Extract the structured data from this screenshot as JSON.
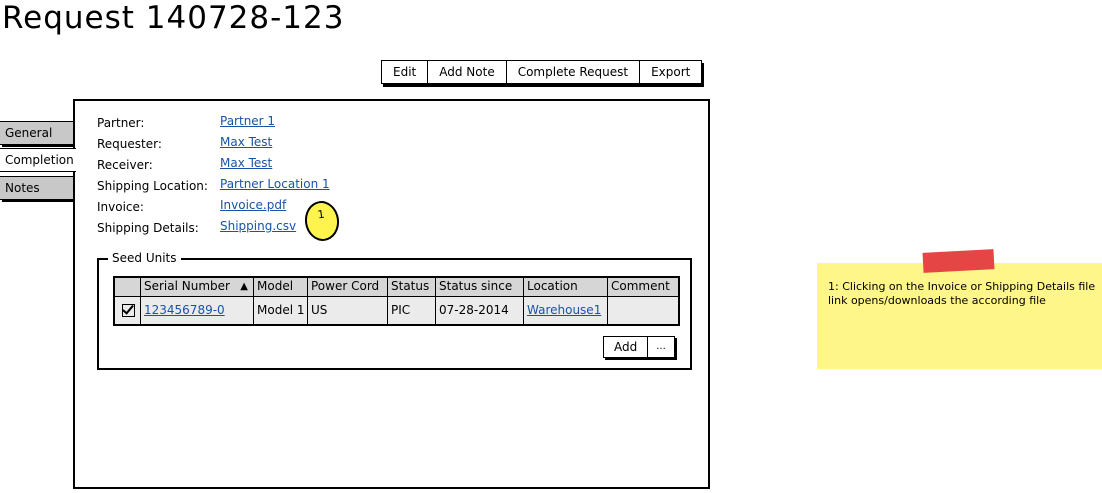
{
  "page": {
    "title": "Request 140728-123"
  },
  "toolbar": {
    "buttons": [
      "Edit",
      "Add Note",
      "Complete Request",
      "Export"
    ]
  },
  "tabs": [
    {
      "label": "General",
      "active": false
    },
    {
      "label": "Completion",
      "active": true
    },
    {
      "label": "Notes",
      "active": false
    }
  ],
  "details": {
    "fields": [
      {
        "label": "Partner:",
        "value": "Partner 1"
      },
      {
        "label": "Requester:",
        "value": "Max Test"
      },
      {
        "label": "Receiver:",
        "value": "Max Test"
      },
      {
        "label": "Shipping Location:",
        "value": "Partner Location 1"
      },
      {
        "label": "Invoice:",
        "value": "Invoice.pdf"
      },
      {
        "label": "Shipping Details:",
        "value": "Shipping.csv"
      }
    ],
    "callout_number": "1"
  },
  "seed_units": {
    "label": "Seed Units",
    "columns": [
      "",
      "Serial Number",
      "Model",
      "Power Cord",
      "Status",
      "Status since",
      "Location",
      "Comment"
    ],
    "sort_indicator": "▲",
    "rows": [
      {
        "checked": true,
        "serial": "123456789-0",
        "model": "Model 1",
        "power_cord": "US",
        "status": "PIC",
        "status_since": "07-28-2014",
        "location": "Warehouse1",
        "comment": ""
      }
    ],
    "add_label": "Add",
    "more_label": "..."
  },
  "note": {
    "text": "1: Clicking on the Invoice or Shipping Details file link opens/downloads the according file",
    "color": "#fff68a",
    "tape_color": "#e64545"
  }
}
